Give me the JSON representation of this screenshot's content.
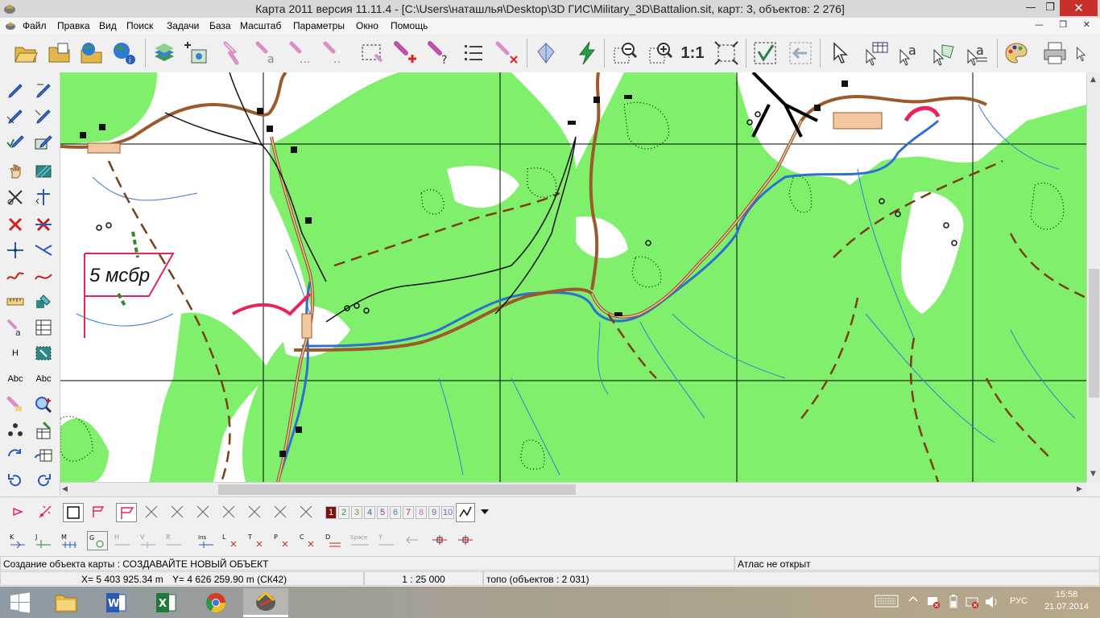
{
  "window": {
    "title": "Карта 2011 версия 11.11.4 - [C:\\Users\\наташлья\\Desktop\\3D ГИС\\Military_3D\\Battalion.sit, карт: 3, объектов: 2 276]",
    "minimize": "—",
    "maximize": "❐",
    "close": "✕"
  },
  "menu": {
    "items": [
      "Файл",
      "Правка",
      "Вид",
      "Поиск",
      "Задачи",
      "База",
      "Масштаб",
      "Параметры",
      "Окно",
      "Помощь"
    ],
    "mdi_buttons": "— ❐ ✕"
  },
  "toolbar": {
    "scale_one_to_one": "1:1"
  },
  "left_tools": {
    "text_h": "H",
    "text_abc": "Abc"
  },
  "map": {
    "unit_label": "5 мсбр",
    "colors": {
      "vegetation": "#80f06c",
      "road": "#9c5a2a",
      "river": "#2f6fcf",
      "stream": "#3a7bd5",
      "grid": "#000000",
      "unit": "#e8245c"
    }
  },
  "layer_numbers": [
    "1",
    "2",
    "3",
    "4",
    "5",
    "6",
    "7",
    "8",
    "9",
    "10"
  ],
  "editor_tools": {
    "items": [
      "K",
      "J",
      "M",
      "G",
      "H",
      "V",
      "R",
      "Ins",
      "L",
      "T",
      "P",
      "C",
      "D",
      "Space",
      "Y"
    ]
  },
  "status": {
    "operation": "Создание объекта карты : СОЗДАВАЙТЕ НОВЫЙ ОБЪЕКТ",
    "atlas": "Атлас не открыт",
    "coord_x": "X= 5 403 925.34 m",
    "coord_y": "Y= 4 626 259.90 m  (СК42)",
    "scale": "1 : 25 000",
    "layer_info": "топо   (объектов : 2 031)"
  },
  "taskbar": {
    "language": "РУС",
    "time": "15:58",
    "date": "21.07.2014"
  }
}
